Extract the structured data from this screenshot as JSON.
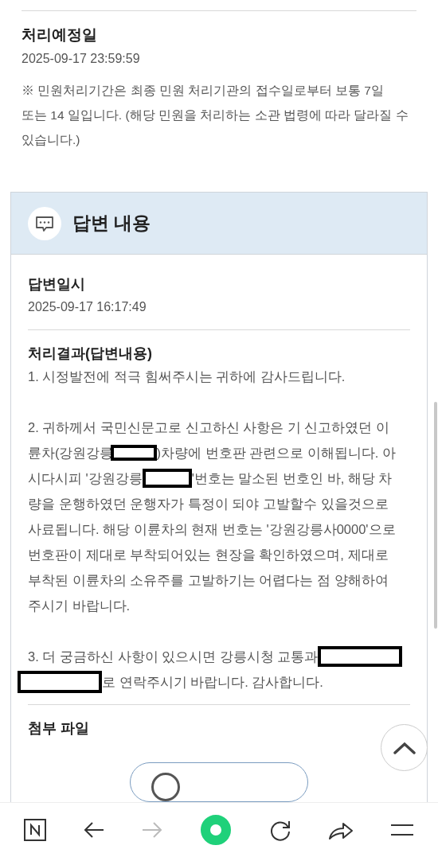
{
  "schedule": {
    "label": "처리예정일",
    "value": "2025-09-17 23:59:59",
    "note_lines": [
      "※ 민원처리기간은 최종 민원 처리기관의 접수일로부터 보통 7일",
      "또는 14 일입니다. (해당 민원을 처리하는 소관 법령에 따라 달라질 수",
      "있습니다.)"
    ]
  },
  "answer": {
    "title": "답변 내용",
    "date_label": "답변일시",
    "date": "2025-09-17 16:17:49",
    "result_label": "처리결과(답변내용)",
    "paragraphs": [
      [
        [
          {
            "kind": "text",
            "text": "1. 시정발전에 적극 힘써주시는 귀하에 감사드립니다."
          }
        ]
      ],
      [
        [
          {
            "kind": "text",
            "text": "2. 귀하께서 국민신문고로 신고하신 사항은 기 신고하였던 이"
          }
        ],
        [
          {
            "kind": "text",
            "text": "륜차(강원강릉"
          },
          {
            "kind": "redacted"
          },
          {
            "kind": "text",
            "text": ")차량에 번호판 관련으로 이해됩니다. 아"
          }
        ],
        [
          {
            "kind": "text",
            "text": "시다시피 '강원강릉"
          },
          {
            "kind": "redacted"
          },
          {
            "kind": "text",
            "text": "'번호는 말소된 번호인 바, 해당 차"
          }
        ],
        [
          {
            "kind": "text",
            "text": "량을 운행하였던 운행자가 특정이 되야 고발할수 있을것으로"
          }
        ],
        [
          {
            "kind": "text",
            "text": "사료됩니다. 해당 이륜차의 현재 번호는 '강원강릉사0000'으로"
          }
        ],
        [
          {
            "kind": "text",
            "text": "번호판이 제대로 부착되어있는 현장을 확인하였으며, 제대로"
          }
        ],
        [
          {
            "kind": "text",
            "text": "부착된 이륜차의 소유주를 고발하기는 어렵다는 점 양해하여"
          }
        ],
        [
          {
            "kind": "text",
            "text": "주시기 바랍니다."
          }
        ]
      ],
      [
        [
          {
            "kind": "text",
            "text": "3. 더 궁금하신 사항이 있으시면 강릉시청 교통과"
          },
          {
            "kind": "redacted"
          }
        ],
        [
          {
            "kind": "redacted"
          },
          {
            "kind": "text",
            "text": "로 연락주시기 바랍니다. 감사합니다."
          }
        ]
      ]
    ],
    "attachment_label": "첨부 파일"
  }
}
